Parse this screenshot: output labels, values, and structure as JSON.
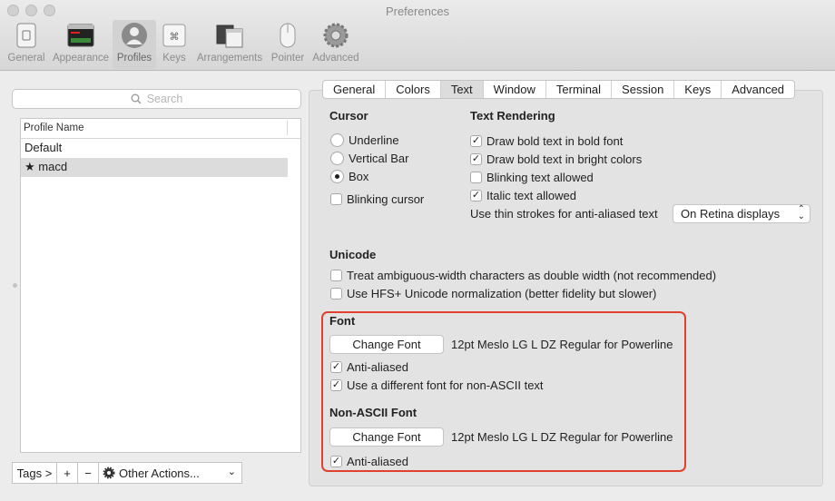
{
  "window": {
    "title": "Preferences"
  },
  "toolbar": [
    {
      "label": "General",
      "icon": "general-icon"
    },
    {
      "label": "Appearance",
      "icon": "appearance-icon"
    },
    {
      "label": "Profiles",
      "icon": "profiles-icon"
    },
    {
      "label": "Keys",
      "icon": "keys-icon"
    },
    {
      "label": "Arrangements",
      "icon": "arrangements-icon"
    },
    {
      "label": "Pointer",
      "icon": "pointer-icon"
    },
    {
      "label": "Advanced",
      "icon": "gear-icon"
    }
  ],
  "selected_toolbar": "Profiles",
  "profiles": {
    "search_placeholder": "Search",
    "column_header": "Profile Name",
    "items": [
      {
        "name": "Default",
        "selected": false
      },
      {
        "name": "★ macd",
        "selected": true
      }
    ],
    "tags_label": "Tags >",
    "add_label": "+",
    "remove_label": "−",
    "other_actions_label": "Other Actions..."
  },
  "tabs": [
    "General",
    "Colors",
    "Text",
    "Window",
    "Terminal",
    "Session",
    "Keys",
    "Advanced"
  ],
  "active_tab": "Text",
  "cursor": {
    "heading": "Cursor",
    "options": [
      {
        "label": "Underline",
        "checked": false
      },
      {
        "label": "Vertical Bar",
        "checked": false
      },
      {
        "label": "Box",
        "checked": true
      }
    ],
    "blinking_label": "Blinking cursor",
    "blinking_checked": false
  },
  "text_rendering": {
    "heading": "Text Rendering",
    "options": [
      {
        "label": "Draw bold text in bold font",
        "checked": true
      },
      {
        "label": "Draw bold text in bright colors",
        "checked": true
      },
      {
        "label": "Blinking text allowed",
        "checked": false
      },
      {
        "label": "Italic text allowed",
        "checked": true
      }
    ],
    "thin_strokes_label": "Use thin strokes for anti-aliased text",
    "thin_strokes_value": "On Retina displays"
  },
  "unicode": {
    "heading": "Unicode",
    "options": [
      {
        "label": "Treat ambiguous-width characters as double width (not recommended)",
        "checked": false
      },
      {
        "label": "Use HFS+ Unicode normalization (better fidelity but slower)",
        "checked": false
      }
    ]
  },
  "font": {
    "heading": "Font",
    "button_label": "Change Font",
    "font_name": "12pt Meslo LG L DZ Regular for Powerline",
    "anti_aliased_label": "Anti-aliased",
    "anti_aliased_checked": true,
    "different_font_label": "Use a different font for non-ASCII text",
    "different_font_checked": true
  },
  "non_ascii_font": {
    "heading": "Non-ASCII Font",
    "button_label": "Change Font",
    "font_name": "12pt Meslo LG L DZ Regular for Powerline",
    "anti_aliased_label": "Anti-aliased",
    "anti_aliased_checked": true
  },
  "colors": {
    "highlight_border": "#e0412f",
    "selected_row": "#dcdcdc"
  }
}
